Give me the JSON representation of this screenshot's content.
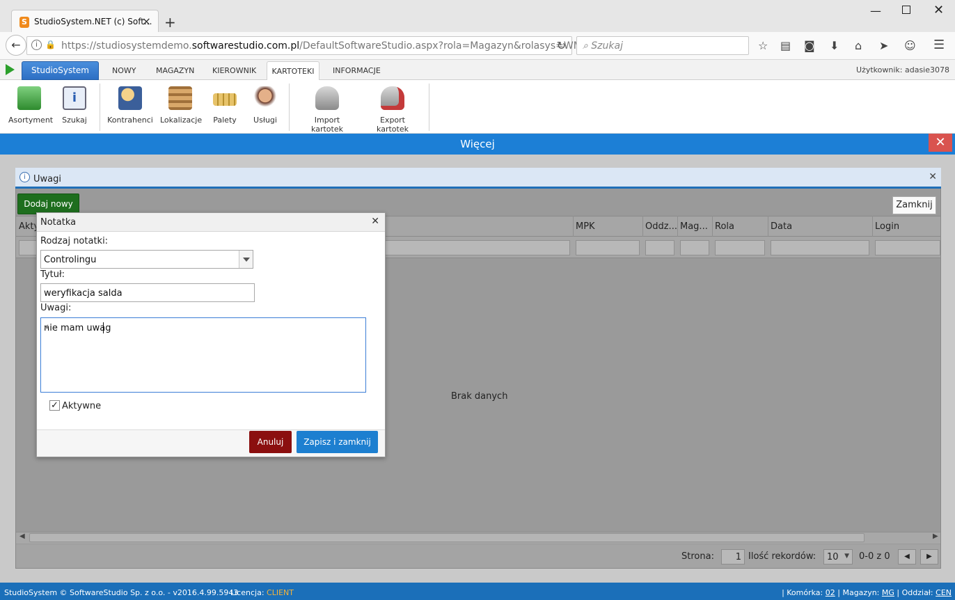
{
  "browser": {
    "tab_title": "StudioSystem.NET (c) Soft...",
    "url_prefix": "https://studiosystemdemo.",
    "url_domain": "softwarestudio.com.pl",
    "url_path": "/DefaultSoftwareStudio.aspx?rola=Magazyn&rolasys=WMS",
    "search_placeholder": "Szukaj"
  },
  "app": {
    "brand_button": "StudioSystem",
    "menu": [
      "NOWY",
      "MAGAZYN",
      "KIEROWNIK",
      "KARTOTEKI",
      "INFORMACJE"
    ],
    "user_label": "Użytkownik: adasie3078"
  },
  "ribbon": {
    "items": [
      "Asortyment",
      "Szukaj",
      "Kontrahenci",
      "Lokalizacje",
      "Palety",
      "Usługi",
      "Import kartotek",
      "Export kartotek"
    ]
  },
  "more_bar": {
    "title": "Więcej",
    "close_icon": "x-icon"
  },
  "uwagi_panel": {
    "title": "Uwagi",
    "add_button": "Dodaj nowy",
    "close_button": "Zamknij",
    "columns": [
      "Akty",
      "MPK",
      "Oddz...",
      "Mag...",
      "Rola",
      "Data",
      "Login"
    ],
    "empty_text": "Brak danych",
    "pager": {
      "page_label": "Strona:",
      "page_value": "1",
      "records_label": "Ilość rekordów:",
      "records_value": "10",
      "range_text": "0-0 z 0"
    }
  },
  "modal": {
    "title": "Notatka",
    "type_label": "Rodzaj notatki:",
    "type_value": "Controlingu",
    "title_label": "Tytuł:",
    "title_value": "weryfikacja salda",
    "notes_label": "Uwagi:",
    "notes_value": "nie mam uwag",
    "active_label": "Aktywne",
    "active_checked": true,
    "cancel_button": "Anuluj",
    "save_button": "Zapisz i zamknij"
  },
  "status": {
    "copyright": "StudioSystem © SoftwareStudio Sp. z o.o. - v2016.4.99.5943",
    "license_label": "Licencja:",
    "license_value": "CLIENT",
    "cell_label": "Komórka:",
    "cell_value": "02",
    "warehouse_label": "Magazyn:",
    "warehouse_value": "MG",
    "branch_label": "Oddział:",
    "branch_value": "CEN"
  },
  "colors": {
    "accent_blue": "#1c7fd6",
    "add_green": "#1e6e1e",
    "cancel_red": "#8b0f0f",
    "close_red": "#d9534f"
  }
}
